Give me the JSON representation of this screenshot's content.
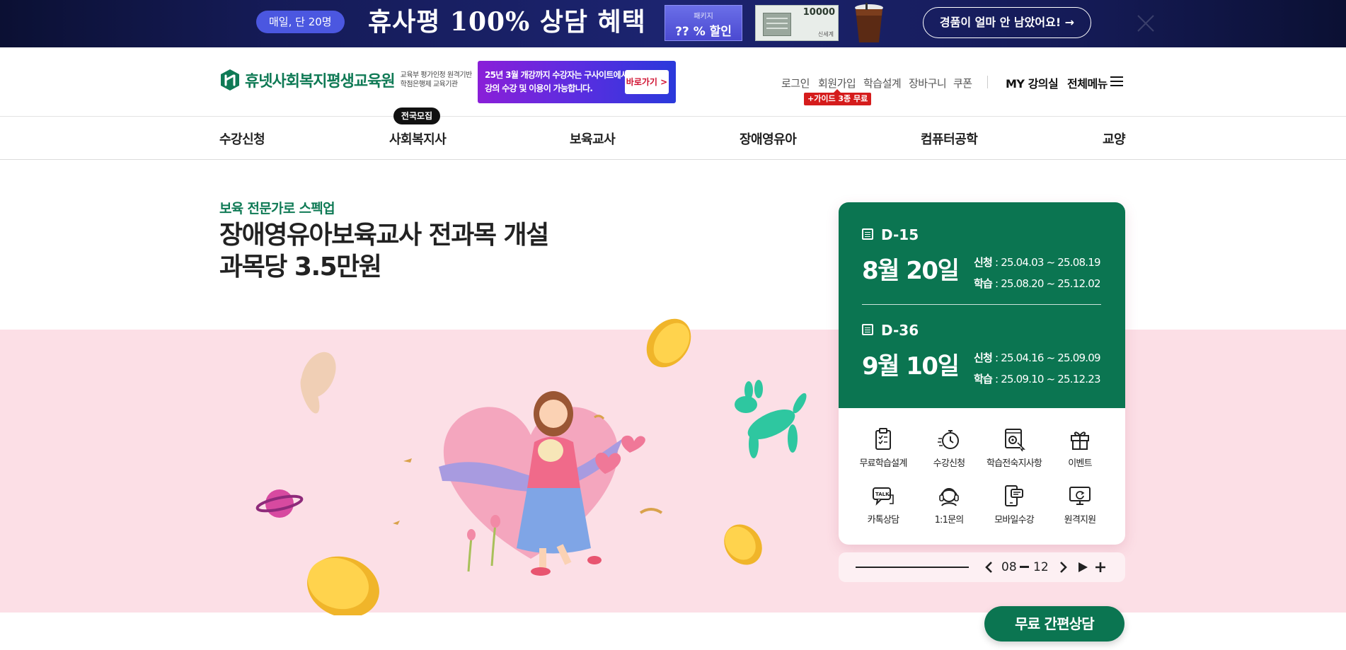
{
  "promo": {
    "pill": "매일, 단 20명",
    "headline": "휴사평 100% 상담 혜택",
    "tag_small": "패키지",
    "tag_big": "?? % 할인",
    "voucher_amount": "10000",
    "voucher_brand": "신세계",
    "cta": "경품이 얼마 안 남았어요! →"
  },
  "header": {
    "logo_text": "휴넷사회복지평생교육원",
    "logo_sub_line1": "교육부 평가인정 원격기반",
    "logo_sub_line2": "학점은행제 교육기관",
    "banner_line1": "25년 3월 개강까지 수강자는 구사이트에서",
    "banner_line2": "강의 수강 및 이용이 가능합니다.",
    "banner_go": "바로가기 >",
    "util_links": [
      "로그인",
      "회원가입",
      "학습설계",
      "장바구니",
      "쿠폰"
    ],
    "util_badge": "+가이드 3종 무료",
    "my_room": "MY 강의실",
    "all_menu": "전체메뉴"
  },
  "gnb": {
    "items": [
      "수강신청",
      "사회복지사",
      "보육교사",
      "장애영유아",
      "컴퓨터공학",
      "교양"
    ],
    "badge": "전국모집"
  },
  "hero": {
    "eyebrow": "보육 전문가로 스펙업",
    "title_line1": "장애영유아보육교사 전과목 개설",
    "title_line2": "과목당 3.5만원"
  },
  "schedule": [
    {
      "dday": "D-15",
      "date": "8월 20일",
      "apply_label": "신청",
      "apply": " : 25.04.03 ~ 25.08.19",
      "study_label": "학습",
      "study": " : 25.08.20 ~ 25.12.02"
    },
    {
      "dday": "D-36",
      "date": "9월 10일",
      "apply_label": "신청",
      "apply": " : 25.04.16 ~ 25.09.09",
      "study_label": "학습",
      "study": " : 25.09.10 ~ 25.12.23"
    }
  ],
  "quick": {
    "items": [
      {
        "label": "무료학습설계",
        "icon": "clipboard-icon"
      },
      {
        "label": "수강신청",
        "icon": "stopwatch-icon"
      },
      {
        "label": "학습전숙지사항",
        "icon": "document-gear-icon"
      },
      {
        "label": "이벤트",
        "icon": "gift-icon"
      },
      {
        "label": "카톡상담",
        "icon": "talk-bubble-icon"
      },
      {
        "label": "1:1문의",
        "icon": "headset-icon"
      },
      {
        "label": "모바일수강",
        "icon": "mobile-chat-icon"
      },
      {
        "label": "원격지원",
        "icon": "monitor-refresh-icon"
      }
    ]
  },
  "slider": {
    "current": "08",
    "total": "12"
  },
  "consult": {
    "label": "무료 간편상담"
  },
  "colors": {
    "brand_green": "#0b7551",
    "hero_pink": "#fcdfe6",
    "promo_navy": "#151b57",
    "badge_red": "#d51c1c"
  }
}
